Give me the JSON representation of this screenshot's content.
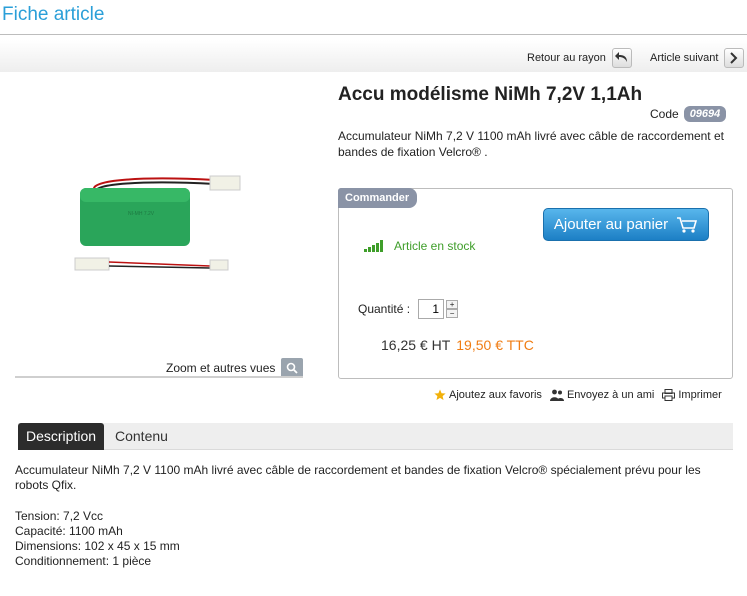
{
  "page": {
    "title": "Fiche article"
  },
  "nav": {
    "back_label": "Retour au rayon",
    "next_label": "Article suivant"
  },
  "product": {
    "title": "Accu modélisme NiMh 7,2V 1,1Ah",
    "code_label": "Code",
    "code": "09694",
    "short_description": "Accumulateur NiMh 7,2 V 1100 mAh livré avec câble de raccordement et bandes de fixation Velcro® ."
  },
  "media": {
    "zoom_label": "Zoom et autres vues"
  },
  "order": {
    "tab_label": "Commander",
    "cart_button": "Ajouter au panier",
    "stock_status": "Article en stock",
    "quantity_label": "Quantité :",
    "quantity_value": "1",
    "price_ht": "16,25 € HT",
    "price_ttc": "19,50 € TTC"
  },
  "actions": {
    "favorites": "Ajoutez aux favoris",
    "send_friend": "Envoyez à un ami",
    "print": "Imprimer"
  },
  "tabs": [
    {
      "label": "Description"
    },
    {
      "label": "Contenu"
    }
  ],
  "description": {
    "text": "Accumulateur NiMh 7,2 V 1100 mAh livré avec câble de raccordement et bandes de fixation Velcro® spécialement prévu pour les robots Qfix.",
    "specs": [
      "Tension: 7,2 Vcc",
      "Capacité: 1100 mAh",
      "Dimensions: 102 x 45 x 15 mm",
      "Conditionnement: 1 pièce"
    ]
  },
  "colors": {
    "title_blue": "#2a9fd8",
    "badge_gray": "#8a93a6",
    "stock_green": "#3f9e2a",
    "price_orange": "#f07d14",
    "cart_blue": "#1c7fc5"
  }
}
